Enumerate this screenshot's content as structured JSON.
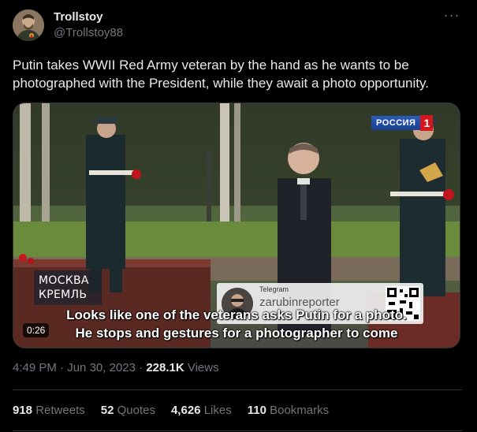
{
  "author": {
    "name": "Trollstoy",
    "handle": "@Trollstoy88",
    "avatar_icon": "user-avatar-icon",
    "more_icon": "more-options-icon"
  },
  "tweet": {
    "text": "Putin takes WWII Red Army veteran by the hand as he wants to be photographed with the President, while they await a photo opportunity."
  },
  "video": {
    "channel_name": "РОССИЯ",
    "channel_number": "1",
    "location_line1": "МОСКВА",
    "location_line2": "КРЕМЛЬ",
    "telegram_label": "Telegram",
    "telegram_handle": "zarubinreporter",
    "subtitle_line1": "Looks like one of the veterans asks Putin for a photo.",
    "subtitle_line2": "He stops and gestures for a photographer to come",
    "timecode": "0:26"
  },
  "meta": {
    "time": "4:49 PM",
    "separator1": "·",
    "date": "Jun 30, 2023",
    "separator2": "·",
    "views_count": "228.1K",
    "views_label": "Views"
  },
  "stats": {
    "retweets_count": "918",
    "retweets_label": "Retweets",
    "quotes_count": "52",
    "quotes_label": "Quotes",
    "likes_count": "4,626",
    "likes_label": "Likes",
    "bookmarks_count": "110",
    "bookmarks_label": "Bookmarks"
  },
  "colors": {
    "background": "#000000",
    "text_primary": "#e7e9ea",
    "text_secondary": "#71767b",
    "divider": "#2f3336"
  }
}
